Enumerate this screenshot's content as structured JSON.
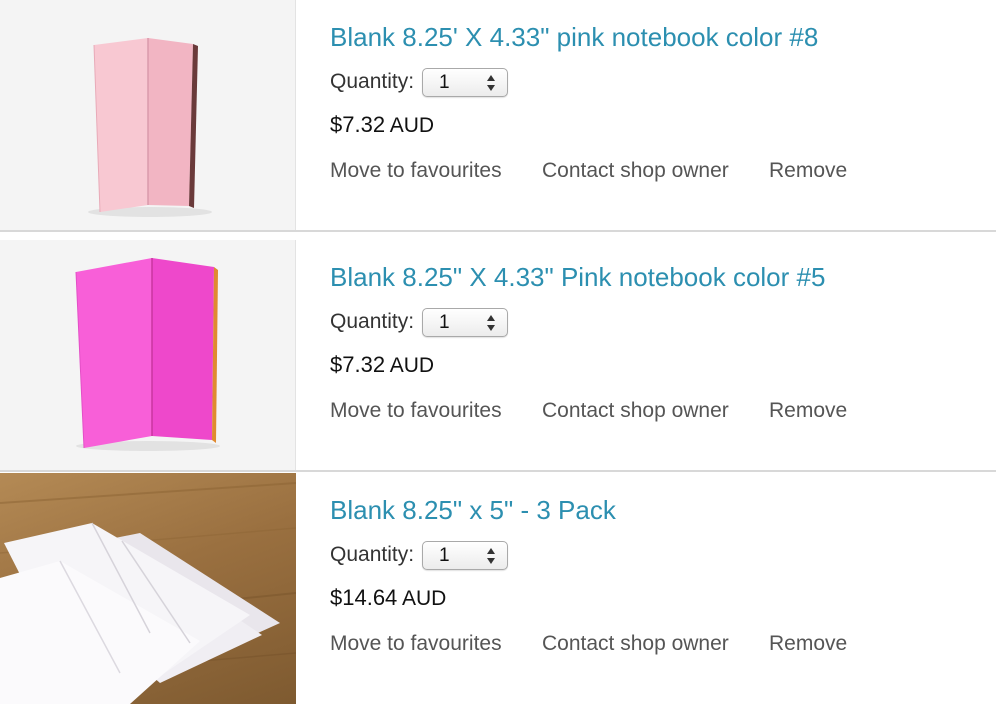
{
  "quantity_label": "Quantity:",
  "actions": {
    "favourite": "Move to favourites",
    "contact": "Contact shop owner",
    "remove": "Remove"
  },
  "items": [
    {
      "title": "Blank 8.25' X 4.33\" pink notebook color #8",
      "quantity": "1",
      "price": "$7.32",
      "currency": "AUD",
      "image": "light-pink-notebook-standing",
      "cover_color": "#f7c3cf"
    },
    {
      "title": "Blank 8.25\" X 4.33\" Pink notebook color #5",
      "quantity": "1",
      "price": "$7.32",
      "currency": "AUD",
      "image": "hot-pink-notebook-standing",
      "cover_color": "#f653d2"
    },
    {
      "title": "Blank 8.25\" x 5\" - 3 Pack",
      "quantity": "1",
      "price": "$14.64",
      "currency": "AUD",
      "image": "white-notebooks-on-wood-table",
      "cover_color": "#f2f0f4"
    }
  ],
  "colors": {
    "link": "#2c8fb0",
    "text": "#333333",
    "action": "#555555",
    "divider": "#d8d8d8"
  }
}
